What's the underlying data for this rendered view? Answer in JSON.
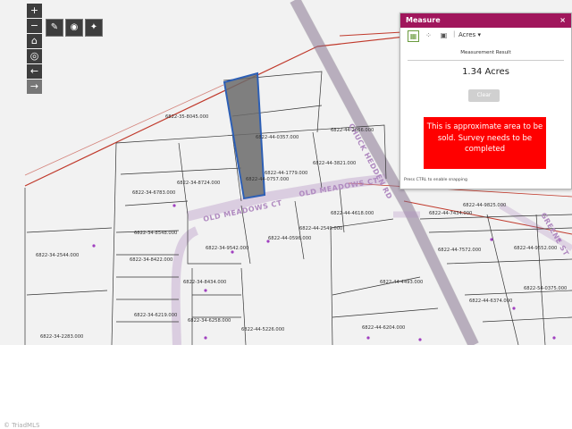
{
  "map": {
    "zoom_controls": {
      "zoom_in": "+",
      "zoom_out": "−"
    },
    "parcels": [
      {
        "id": "6822-35-8045.000"
      },
      {
        "id": "6822-44-0357.000"
      },
      {
        "id": "6822-44-2066.000"
      },
      {
        "id": "6822-44-1779.000"
      },
      {
        "id": "6822-44-3821.000"
      },
      {
        "id": "6822-44-0757.000"
      },
      {
        "id": "6822-44-4618.000"
      },
      {
        "id": "6822-44-7434.000"
      },
      {
        "id": "6822-44-9825.000"
      },
      {
        "id": "6822-34-6783.000"
      },
      {
        "id": "6822-34-8724.000"
      },
      {
        "id": "6822-34-8548.000"
      },
      {
        "id": "6822-34-9542.000"
      },
      {
        "id": "6822-34-8422.000"
      },
      {
        "id": "6822-34-2544.000"
      },
      {
        "id": "6822-44-0596.000"
      },
      {
        "id": "6822-44-2549.000"
      },
      {
        "id": "6822-44-7572.000"
      },
      {
        "id": "6822-44-9552.000"
      },
      {
        "id": "6822-44-6374.000"
      },
      {
        "id": "6822-54-0375.000"
      },
      {
        "id": "6822-44-4493.000"
      },
      {
        "id": "6822-34-8434.000"
      },
      {
        "id": "6822-34-6219.000"
      },
      {
        "id": "6822-34-6258.000"
      },
      {
        "id": "6822-44-6204.000"
      },
      {
        "id": "6822-44-5226.000"
      },
      {
        "id": "6822-34-2283.000"
      }
    ],
    "road_labels": [
      "OLD MEADOWS CT",
      "CHUCK HEDDEN RD",
      "OLD MEADOWS CT",
      "GREENE ST"
    ],
    "highlight_color": "#6b6b6b",
    "lot_line_color": "#333333",
    "boundary_color": "#c0392b",
    "road_color": "#b08ac0"
  },
  "measure_panel": {
    "title": "Measure",
    "close": "×",
    "unit": "Acres",
    "result_label": "Measurement Result",
    "result_value": "1.34 Acres",
    "clear_label": "Clear",
    "note": "This is approximate area to be sold.  Survey needs to be completed",
    "hint": "Press CTRL to enable snapping",
    "header_color": "#a0165c",
    "note_color": "#ff0000"
  },
  "watermark": "© TriadMLS"
}
